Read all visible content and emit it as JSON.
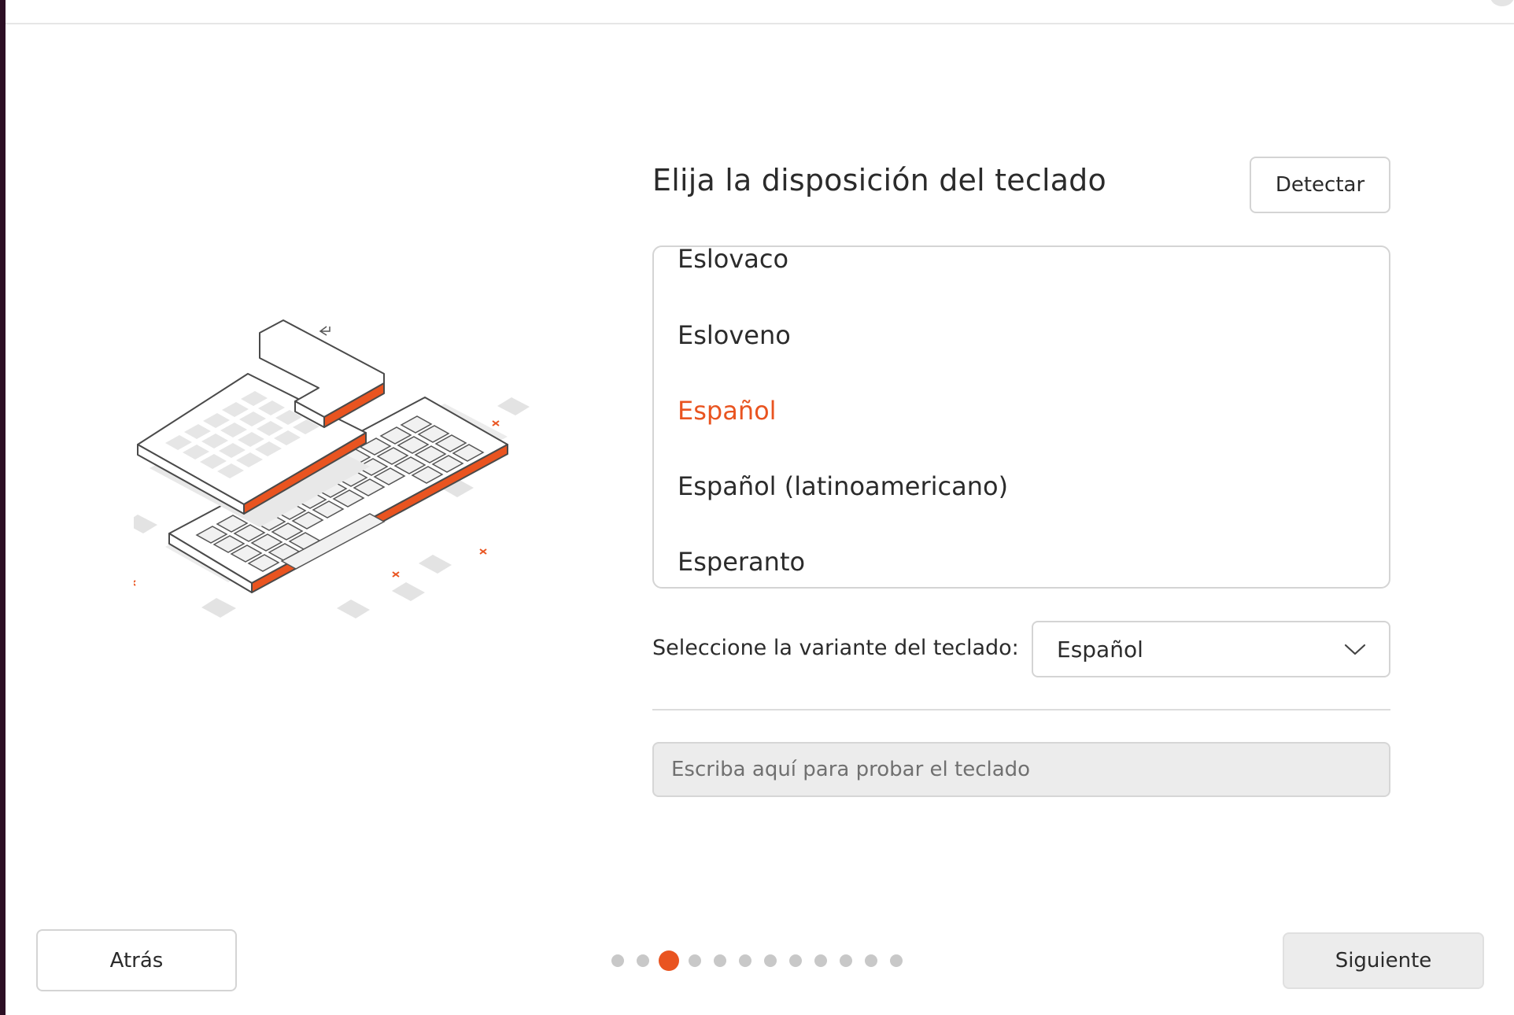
{
  "page": {
    "heading": "Elija la disposición del teclado",
    "detect_label": "Detectar"
  },
  "layout_list": {
    "items": [
      {
        "label": "Eslovaco",
        "selected": false
      },
      {
        "label": "Esloveno",
        "selected": false
      },
      {
        "label": "Español",
        "selected": true
      },
      {
        "label": "Español (latinoamericano)",
        "selected": false
      },
      {
        "label": "Esperanto",
        "selected": false
      }
    ]
  },
  "variant": {
    "label": "Seleccione la variante del teclado:",
    "value": "Español",
    "icon": "chevron-down-icon"
  },
  "test_field": {
    "placeholder": "Escriba aquí para probar el teclado",
    "value": ""
  },
  "footer": {
    "back_label": "Atrás",
    "next_label": "Siguiente",
    "pager": {
      "total": 12,
      "current": 3
    }
  },
  "colors": {
    "accent": "#e95420",
    "border": "#d4d4d4",
    "dot_inactive": "#c8c8c8",
    "input_bg": "#ececec",
    "window_edge": "#2c0f24"
  }
}
